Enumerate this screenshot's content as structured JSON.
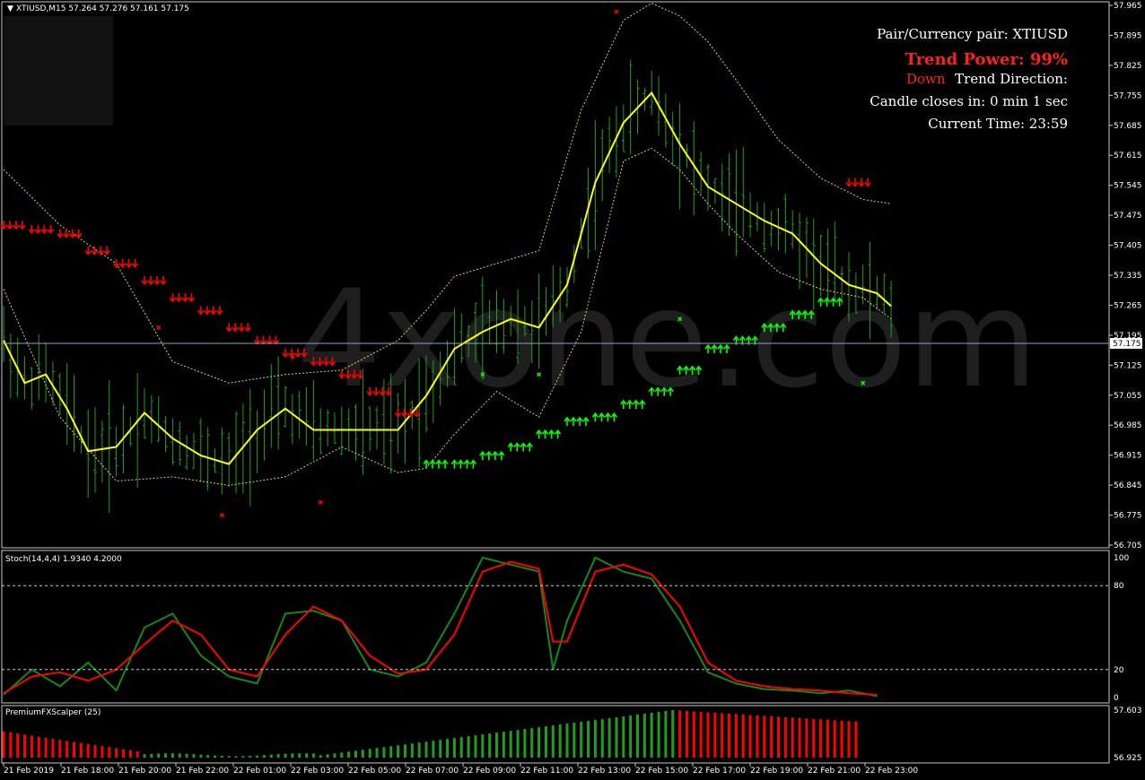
{
  "header": {
    "symbol_line": "XTIUSD,M15  57.264 57.276 57.161 57.175",
    "stoch_label": "Stoch(14,4,4) 1.9340 4.2000",
    "scalper_label": "PremiumFXScalper (25)"
  },
  "watermark": "4xone.com",
  "info_panel": {
    "pair_line": "Pair/Currency pair: XTIUSD",
    "trend_power": "Trend Power: 99%",
    "trend_direction_value": "Down",
    "trend_direction_label": "Trend Direction:",
    "candle_close": "Candle closes in: 0 min 1 sec",
    "current_time": "Current Time: 23:59"
  },
  "colors": {
    "background": "#000000",
    "candle": "#1f9e1f",
    "ma": "#ffff00",
    "band": "#d8d84a",
    "sell_arrow": "#ff0000",
    "buy_arrow": "#00ff00",
    "stoch_main": "#138a13",
    "stoch_signal": "#ff0000",
    "current_price_line": "#8aa7c4"
  },
  "chart_data": [
    {
      "type": "line",
      "title": "XTIUSD,M15",
      "ylim": [
        56.7,
        57.965
      ],
      "y_ticks": [
        "57.965",
        "57.895",
        "57.825",
        "57.755",
        "57.685",
        "57.615",
        "57.545",
        "57.475",
        "57.405",
        "57.335",
        "57.265",
        "57.195",
        "57.125",
        "57.055",
        "56.985",
        "56.915",
        "56.845",
        "56.775",
        "56.705"
      ],
      "current_price": "57.175",
      "x_ticks": [
        "21 Feb 2019",
        "21 Feb 18:00",
        "21 Feb 20:00",
        "21 Feb 22:00",
        "22 Feb 01:00",
        "22 Feb 03:00",
        "22 Feb 05:00",
        "22 Feb 07:00",
        "22 Feb 09:00",
        "22 Feb 11:00",
        "22 Feb 13:00",
        "22 Feb 15:00",
        "22 Feb 17:00",
        "22 Feb 19:00",
        "22 Feb 21:00",
        "22 Feb 23:00"
      ],
      "series": [
        {
          "x": [
            0,
            3,
            6,
            9,
            12,
            16,
            20,
            24,
            28,
            32,
            36,
            40,
            44,
            48,
            52,
            56,
            60,
            64,
            68,
            72,
            76,
            80,
            84,
            88,
            92,
            96,
            100,
            104,
            108,
            112,
            116,
            120,
            124,
            126
          ],
          "values": [
            57.18,
            57.08,
            57.1,
            57.02,
            56.92,
            56.93,
            57.01,
            56.95,
            56.91,
            56.89,
            56.97,
            57.02,
            56.97,
            56.97,
            56.97,
            56.97,
            57.05,
            57.16,
            57.2,
            57.23,
            57.21,
            57.31,
            57.55,
            57.69,
            57.76,
            57.64,
            57.54,
            57.5,
            57.46,
            57.43,
            57.36,
            57.31,
            57.29,
            57.26
          ]
        },
        {
          "x": [
            0,
            8,
            16,
            24,
            32,
            40,
            48,
            56,
            60,
            64,
            70,
            76,
            82,
            88,
            92,
            96,
            100,
            104,
            110,
            116,
            122,
            126
          ],
          "values": [
            57.58,
            57.45,
            57.36,
            57.13,
            57.08,
            57.1,
            57.11,
            57.18,
            57.25,
            57.33,
            57.36,
            57.39,
            57.72,
            57.93,
            57.97,
            57.94,
            57.88,
            57.79,
            57.65,
            57.56,
            57.51,
            57.5
          ]
        },
        {
          "x": [
            0,
            8,
            16,
            24,
            32,
            40,
            48,
            56,
            60,
            64,
            70,
            76,
            82,
            88,
            92,
            96,
            100,
            104,
            110,
            116,
            122,
            126
          ],
          "values": [
            57.3,
            57.0,
            56.85,
            56.86,
            56.84,
            56.86,
            56.93,
            56.87,
            56.88,
            56.96,
            57.06,
            57.0,
            57.2,
            57.6,
            57.63,
            57.58,
            57.5,
            57.43,
            57.34,
            57.3,
            57.28,
            57.23
          ]
        }
      ]
    },
    {
      "type": "line",
      "title": "Stoch(14,4,4)",
      "ylim": [
        0,
        100
      ],
      "y_ticks": [
        "100",
        "80",
        "20",
        "0"
      ],
      "series": [
        {
          "x": [
            0,
            4,
            8,
            12,
            16,
            20,
            24,
            28,
            32,
            36,
            40,
            44,
            48,
            52,
            56,
            60,
            64,
            68,
            72,
            76,
            78,
            80,
            84,
            88,
            92,
            96,
            100,
            104,
            108,
            112,
            116,
            120,
            124
          ],
          "values": [
            2,
            20,
            8,
            25,
            5,
            50,
            60,
            30,
            15,
            10,
            60,
            62,
            55,
            20,
            15,
            25,
            60,
            100,
            95,
            90,
            20,
            55,
            100,
            90,
            85,
            55,
            18,
            10,
            6,
            5,
            3,
            5,
            1
          ]
        },
        {
          "x": [
            0,
            4,
            8,
            12,
            16,
            20,
            24,
            28,
            32,
            36,
            40,
            44,
            48,
            52,
            56,
            60,
            64,
            68,
            72,
            76,
            78,
            80,
            84,
            88,
            92,
            96,
            100,
            104,
            108,
            112,
            116,
            120,
            124
          ],
          "values": [
            3,
            15,
            18,
            12,
            20,
            38,
            55,
            45,
            20,
            15,
            45,
            65,
            55,
            30,
            17,
            20,
            45,
            90,
            97,
            92,
            40,
            40,
            90,
            95,
            88,
            65,
            25,
            12,
            8,
            6,
            5,
            3,
            2
          ]
        }
      ]
    },
    {
      "type": "bar",
      "title": "PremiumFXScalper (25)",
      "ylim": [
        56.925,
        57.603
      ],
      "y_ticks": [
        "57.603",
        "56.925"
      ],
      "bars": "generated by script"
    }
  ]
}
